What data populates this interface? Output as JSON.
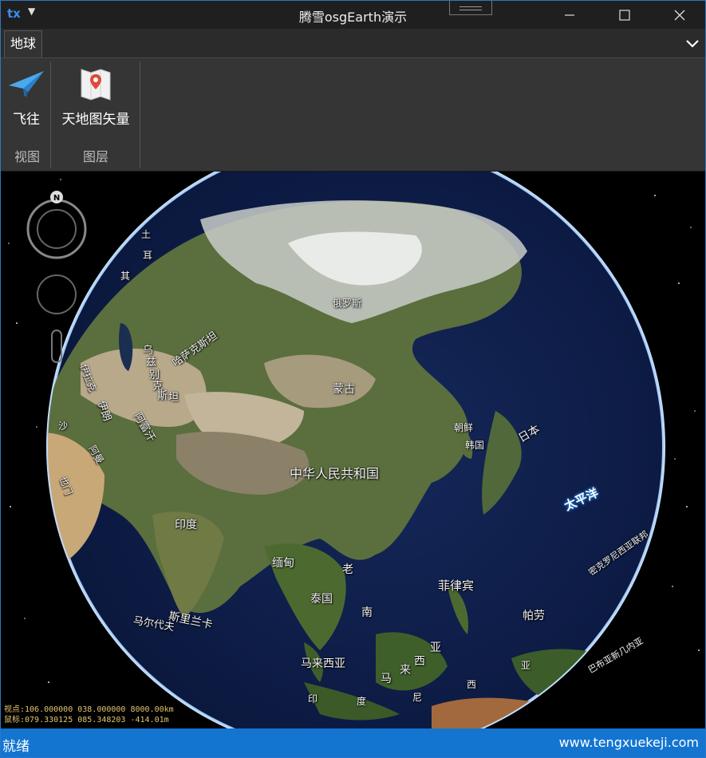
{
  "window": {
    "title": "腾雪osgEarth演示"
  },
  "ribbon": {
    "tabs": [
      {
        "label": "地球"
      }
    ],
    "groups": [
      {
        "label": "视图",
        "buttons": [
          {
            "label": "飞往",
            "icon": "paper-plane-icon"
          }
        ]
      },
      {
        "label": "图层",
        "buttons": [
          {
            "label": "天地图矢量",
            "icon": "map-pin-icon"
          }
        ]
      }
    ]
  },
  "globe": {
    "labels": {
      "russia": "俄罗斯",
      "mongolia": "蒙古",
      "kazakhstan": "哈萨克斯坦",
      "china": "中华人民共和国",
      "korea": "朝鲜",
      "south_korea": "韩国",
      "japan": "日本",
      "pacific": "太平洋",
      "india": "印度",
      "myanmar": "缅甸",
      "laos": "老",
      "thailand": "泰国",
      "vietnam": "南",
      "philippines": "菲律宾",
      "palau": "帕劳",
      "malaysia": "马来西亚",
      "sri_lanka": "斯里兰卡",
      "maldives": "马尔代夫",
      "indonesia_1": "印",
      "indonesia_2": "度",
      "indonesia_3": "尼",
      "indonesia_4": "西",
      "indonesia_5": "亚",
      "sea_1": "马",
      "sea_2": "来",
      "sea_3": "西",
      "sea_4": "亚",
      "micronesia": "密克罗尼西亚联邦",
      "png": "巴布亚新几内亚",
      "afghanistan": "阿富汗",
      "iran": "伊朗",
      "xinjiang_1": "乌",
      "xinjiang_2": "兹",
      "xinjiang_3": "别",
      "xinjiang_4": "克",
      "xinjiang_5": "斯",
      "xinjiang_6": "坦",
      "oman": "阿曼",
      "yemen": "也门",
      "saudi": "沙",
      "iraq": "伊拉克",
      "turkey_1": "土",
      "turkey_2": "耳",
      "turkey_3": "其"
    },
    "compass": "N"
  },
  "coords": {
    "viewpoint": "视点:106.000000 038.000000 8000.00km",
    "mouse": "鼠标:079.330125 085.348203 -414.01m"
  },
  "status": {
    "left": "就绪",
    "right": "www.tengxuekeji.com"
  }
}
